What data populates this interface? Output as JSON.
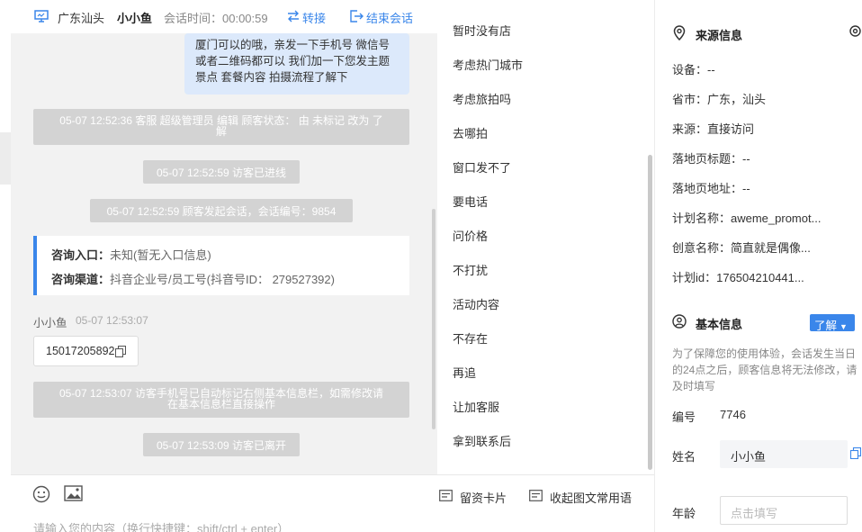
{
  "header": {
    "location": "广东汕头",
    "customer_name": "小小鱼",
    "session_time": "会话时间：00:00:59",
    "transfer_label": "转接",
    "end_label": "结束会话"
  },
  "messages": {
    "agent_bubble_lines": [
      "厦门可以的哦，亲发一下手机号 微信号",
      "或者二维码都可以 我们加一下您发主题",
      "景点 套餐内容 拍摄流程了解下"
    ],
    "sys1_line1": "05-07 12:52:36 客服 超级管理员 编辑 顾客状态： 由 未标记 改为 了",
    "sys1_line2": "解",
    "sys2": "05-07 12:52:59 访客已进线",
    "sys3": "05-07 12:52:59 顾客发起会话，会话编号：9854",
    "entry_label": "咨询入口：",
    "entry_value": "未知(暂无入口信息)",
    "channel_label": "咨询渠道：",
    "channel_value": "抖音企业号/员工号(抖音号ID： 279527392)",
    "customer_sender": "小小鱼",
    "customer_time": "05-07 12:53:07",
    "phone": "15017205892",
    "sys4_line1": "05-07 12:53:07 访客手机号已自动标记右侧基本信息栏，如需修改请",
    "sys4_line2": "在基本信息栏直接操作",
    "sys5": "05-07 12:53:09 访客已离开"
  },
  "input": {
    "placeholder": "请输入您的内容（换行快捷键：shift/ctrl + enter）",
    "emoji_icon": "emoji-icon",
    "image_icon": "image-icon",
    "card_label": "留资卡片",
    "collapse_label": "收起图文常用语"
  },
  "quick_replies": [
    "暂时没有店",
    "考虑热门城市",
    "考虑旅拍吗",
    "去哪拍",
    "窗口发不了",
    "要电话",
    "问价格",
    "不打扰",
    "活动内容",
    "不存在",
    "再追",
    "让加客服",
    "拿到联系后"
  ],
  "source": {
    "title": "来源信息",
    "device": "设备：--",
    "province": "省市：广东，汕头",
    "origin": "来源：直接访问",
    "landing_title": "落地页标题：--",
    "landing_url": "落地页地址：--",
    "plan_name": "计划名称：aweme_promot...",
    "creative_name": "创意名称：简直就是偶像...",
    "plan_id": "计划id：176504210441..."
  },
  "basic": {
    "title": "基本信息",
    "learn_more": "了解",
    "notice": "为了保障您的使用体验，会话发生当日的24点之后，顾客信息将无法修改，请及时填写",
    "id_label": "编号",
    "id_value": "7746",
    "name_label": "姓名",
    "name_value": "小小鱼",
    "age_label": "年龄",
    "age_placeholder": "点击填写"
  },
  "colors": {
    "accent": "#3a86ea",
    "agent_bubble": "#dce9fb",
    "system_message": "#d3d3d3"
  }
}
